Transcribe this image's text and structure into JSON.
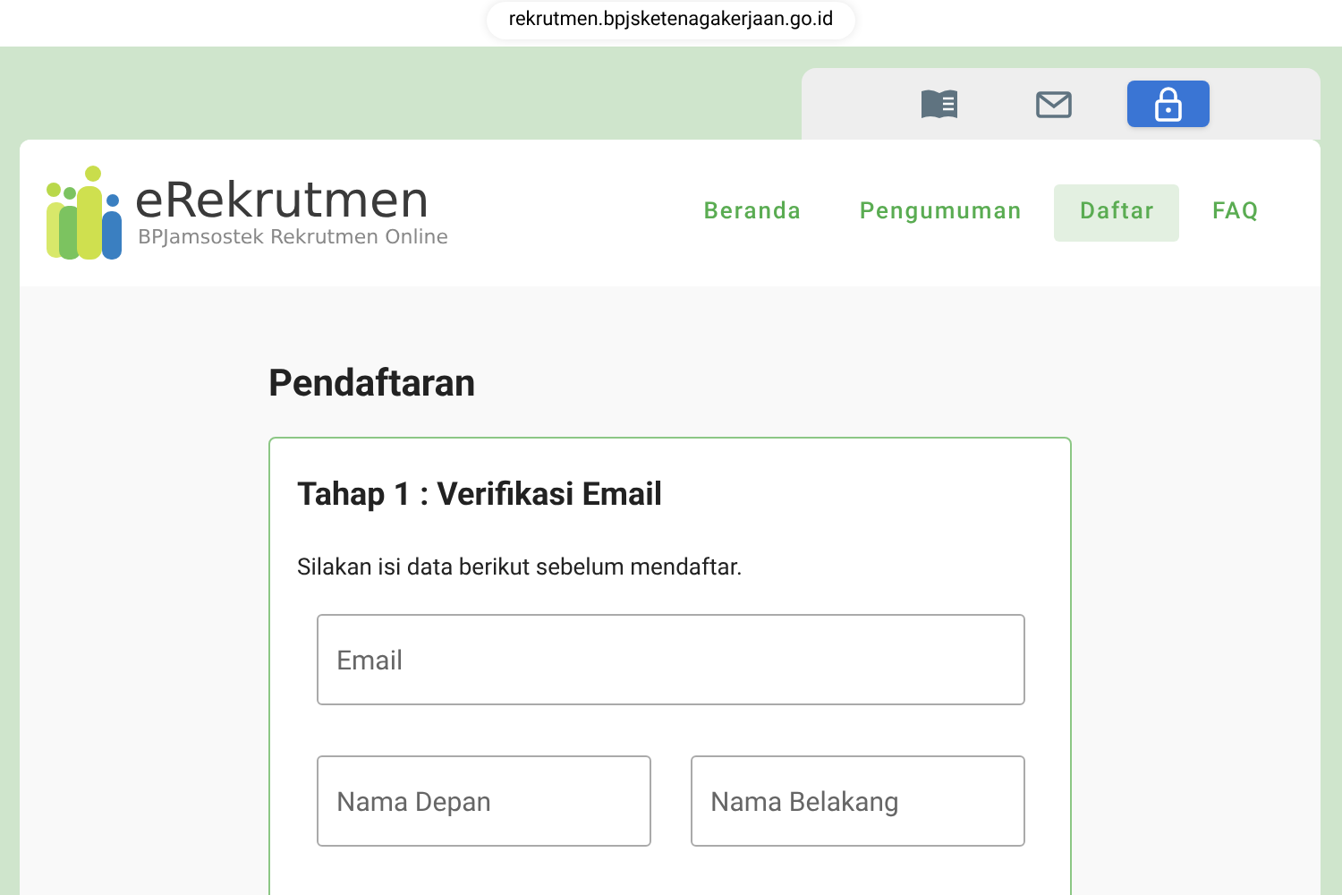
{
  "browser": {
    "url": "rekrutmen.bpjsketenagakerjaan.go.id"
  },
  "toolbar": [
    {
      "kind": "book",
      "selected": false
    },
    {
      "kind": "mail",
      "selected": false
    },
    {
      "kind": "lock",
      "selected": true
    }
  ],
  "logo": {
    "title": "eRekrutmen",
    "subtitle": "BPJamsostek Rekrutmen Online"
  },
  "nav": [
    {
      "label": "Beranda",
      "selected": false
    },
    {
      "label": "Pengumuman",
      "selected": false
    },
    {
      "label": "Daftar",
      "selected": true
    },
    {
      "label": "FAQ",
      "selected": false
    }
  ],
  "page": {
    "title": "Pendaftaran"
  },
  "form": {
    "step": "Tahap 1 : Verifikasi Email",
    "instructions": "Silakan isi data berikut sebelum mendaftar.",
    "fields": [
      {
        "placeholder": "Email"
      },
      {
        "placeholder": "Nama Depan"
      },
      {
        "placeholder": "Nama Belakang"
      }
    ]
  }
}
